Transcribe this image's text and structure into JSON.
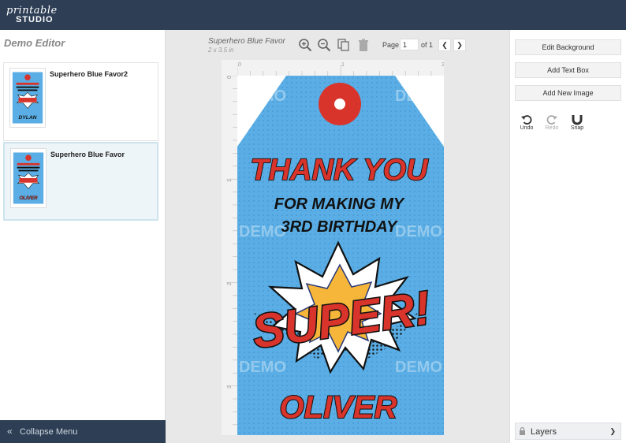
{
  "app": {
    "logo_top": "printable",
    "logo_bottom": "STUDIO"
  },
  "left_panel": {
    "title": "Demo Editor",
    "designs": [
      {
        "name": "Superhero Blue Favor2",
        "thumb_name": "DYLAN",
        "selected": false
      },
      {
        "name": "Superhero Blue Favor",
        "thumb_name": "OLIVER",
        "selected": true
      }
    ],
    "collapse_label": "Collapse Menu"
  },
  "canvas": {
    "doc_title": "Superhero Blue Favor",
    "doc_size": "2 x 3.5 in",
    "page_label": "Page",
    "page_value": "1",
    "page_of": "of 1",
    "prev_icon": "chevron-left-icon",
    "next_icon": "chevron-right-icon",
    "ruler_top_labels": [
      "0",
      "1",
      "2"
    ],
    "ruler_left_labels": [
      "0",
      "1",
      "2",
      "3"
    ],
    "tag": {
      "line1": "THANK YOU",
      "line2": "FOR MAKING MY",
      "line3": "3RD BIRTHDAY",
      "burst_text": "SUPER!",
      "name": "OLIVER",
      "watermark": "DEMO",
      "colors": {
        "blue": "#5aaee5",
        "red": "#d8342b",
        "black": "#111111",
        "yellow": "#f5b63a"
      }
    }
  },
  "right_panel": {
    "buttons": [
      "Edit Background",
      "Add Text Box",
      "Add New Image"
    ],
    "tools": [
      {
        "label": "Undo",
        "icon": "undo-icon",
        "enabled": true
      },
      {
        "label": "Redo",
        "icon": "redo-icon",
        "enabled": false
      },
      {
        "label": "Snap",
        "icon": "magnet-icon",
        "enabled": true
      }
    ],
    "layers_label": "Layers"
  },
  "colors": {
    "header": "#2d3e55",
    "selected_card": "#eef5f8"
  }
}
